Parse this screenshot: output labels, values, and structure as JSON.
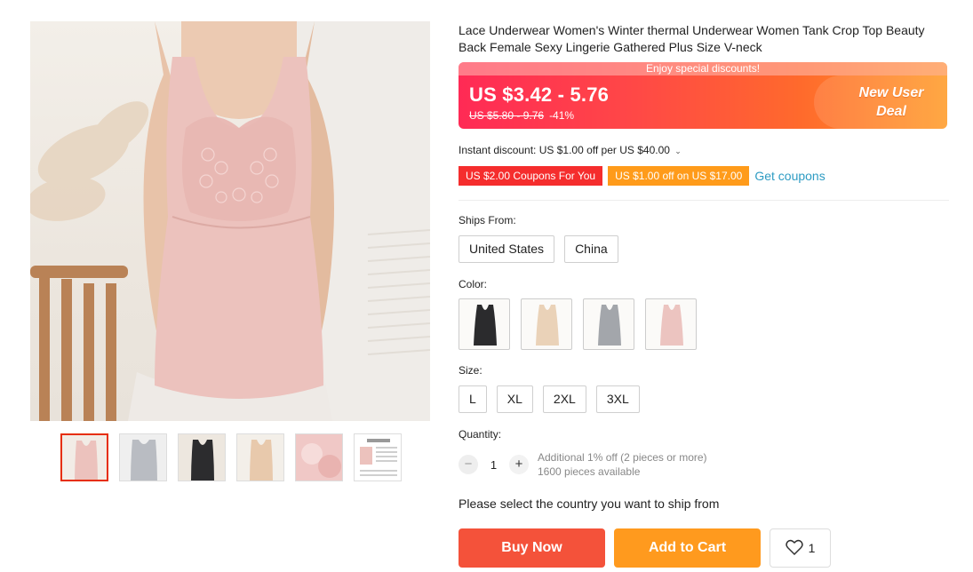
{
  "product": {
    "title": "Lace Underwear Women's Winter thermal Underwear Women Tank Crop Top Beauty Back Female Sexy Lingerie Gathered Plus Size V-neck"
  },
  "price": {
    "banner_strip": "Enjoy special discounts!",
    "current": "US $3.42 - 5.76",
    "original": "US $5.80 - 9.76",
    "discount": "-41%",
    "deal_line1": "New User",
    "deal_line2": "Deal"
  },
  "discounts": {
    "instant": "Instant discount: US $1.00 off per US $40.00",
    "coupon1": "US $2.00 Coupons For You",
    "coupon2": "US $1.00 off on US $17.00",
    "get_coupons": "Get coupons"
  },
  "ships_from": {
    "label": "Ships From:",
    "options": [
      "United States",
      "China"
    ]
  },
  "color": {
    "label": "Color:",
    "swatches": [
      "black",
      "beige",
      "gray",
      "pink"
    ]
  },
  "size": {
    "label": "Size:",
    "options": [
      "L",
      "XL",
      "2XL",
      "3XL"
    ]
  },
  "quantity": {
    "label": "Quantity:",
    "value": "1",
    "minus": "−",
    "plus": "+",
    "info1": "Additional 1% off (2 pieces or more)",
    "info2": "1600 pieces available"
  },
  "ship_message": "Please select the country you want to ship from",
  "actions": {
    "buy_now": "Buy Now",
    "add_to_cart": "Add to Cart",
    "wishlist_count": "1"
  },
  "colors": {
    "accent_red": "#f52d2d",
    "accent_orange": "#ff9b1a",
    "link_blue": "#2e9cc3"
  }
}
